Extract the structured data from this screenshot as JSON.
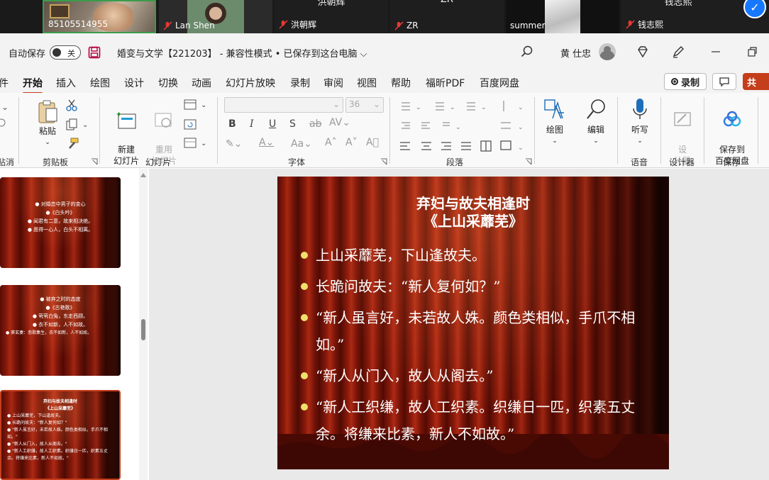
{
  "meeting": {
    "participants": [
      {
        "name": "85105514955",
        "muted": false
      },
      {
        "name": "Lan Shen",
        "muted": true
      },
      {
        "name": "洪朝辉",
        "muted": true,
        "top_label": "洪朝辉"
      },
      {
        "name": "ZR",
        "muted": true,
        "top_label": "ZR"
      },
      {
        "name": "summer",
        "muted": false
      },
      {
        "name": "钱志熙",
        "muted": true,
        "top_label": "钱志熙"
      }
    ]
  },
  "titlebar": {
    "autosave_label": "自动保存",
    "autosave_state": "关",
    "doc_title": "婚变与文学【221203】 - 兼容性模式 • 已保存到这台电脑 ⌵",
    "user_name": "黄 仕忠"
  },
  "tabs": [
    "件",
    "开始",
    "插入",
    "绘图",
    "设计",
    "切换",
    "动画",
    "幻灯片放映",
    "录制",
    "审阅",
    "视图",
    "帮助",
    "福昕PDF",
    "百度网盘"
  ],
  "active_tab": "开始",
  "record_label": "录制",
  "share_label": "共",
  "ribbon": {
    "groups": {
      "partial": "贴消",
      "clipboard": "剪贴板",
      "slides": "幻灯片",
      "font": "字体",
      "paragraph": "段落",
      "voice": "语音",
      "designer": "设计器",
      "save": "保存"
    },
    "buttons": {
      "paste": "粘贴",
      "new_slide": "新建\n幻灯片",
      "reuse_slide": "重用\n幻灯片",
      "drawing": "绘图",
      "editing": "编辑",
      "dictate": "听写",
      "designer": "设\n计器",
      "save_baidu": "保存到\n百度网盘"
    },
    "font_size": "36"
  },
  "thumbnails": [
    {
      "lines": [
        "● 对婚恋中男子的变心",
        "●《白头吟》",
        "● 闻君有二意，故来相决绝。",
        "● 愿得一心人，白头不相离。"
      ]
    },
    {
      "lines": [
        "● 被弃之时的态度",
        "●《古艳歌》",
        "● 茕茕白兔，东走西顾。",
        "● 衣不如新，人不如故。",
        "",
        "● 窦玄妻：悲歌集生，衣不如新，人不如故。"
      ]
    },
    {
      "lines": [
        "弃妇与故夫相逢时",
        "《上山采蘼芜》",
        "● 上山采蘼芜，下山逢故夫。",
        "● 长跪问故夫：\"新人复何如？\"",
        "● \"新人虽言好，未若故人姝。颜色类相似，手爪不相如。\"",
        "● \"新人从门入，故人从阁去。\"",
        "● \"新人工织缣，故人工织素。织缣日一匹，织素五丈余。将缣来比素，新人不如故。\""
      ]
    }
  ],
  "slide": {
    "title_line1": "弃妇与故夫相逢时",
    "title_line2": "《上山采蘼芜》",
    "bullets": [
      "上山采蘼芜，下山逢故夫。",
      "长跪问故夫：“新人复何如？”",
      "“新人虽言好，未若故人姝。颜色类相似，手爪不相如。”",
      "“新人从门入，故人从阁去。”",
      "“新人工织缣，故人工织素。织缣日一匹，织素五丈余。将缣来比素，新人不如故。”"
    ]
  },
  "colors": {
    "accent": "#c43e1c",
    "bullet": "#f0e06c",
    "curtain": "#8d1a0b"
  }
}
